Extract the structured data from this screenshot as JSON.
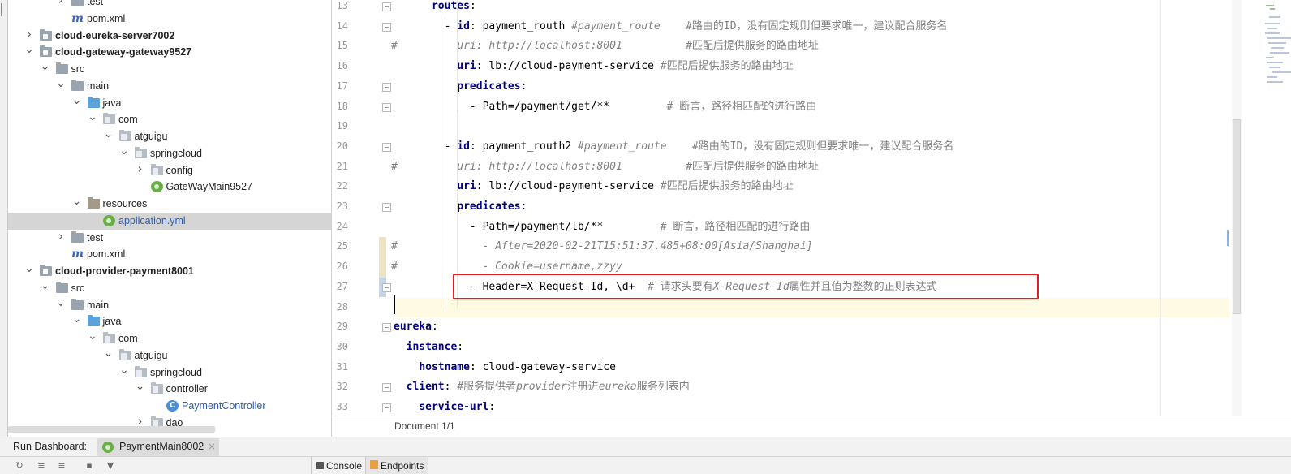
{
  "project_tree": {
    "rows": [
      {
        "label": "test",
        "depth": 3,
        "arrow": ">",
        "icon": "folder-icon",
        "style": "normal"
      },
      {
        "label": "pom.xml",
        "depth": 3,
        "arrow": "",
        "icon": "maven-icon",
        "style": "normal"
      },
      {
        "label": "cloud-eureka-server7002",
        "depth": 1,
        "arrow": ">",
        "icon": "module-folder-icon",
        "style": "bold"
      },
      {
        "label": "cloud-gateway-gateway9527",
        "depth": 1,
        "arrow": "v",
        "icon": "module-folder-icon",
        "style": "bold"
      },
      {
        "label": "src",
        "depth": 2,
        "arrow": "v",
        "icon": "folder-icon",
        "style": "normal"
      },
      {
        "label": "main",
        "depth": 3,
        "arrow": "v",
        "icon": "folder-icon",
        "style": "normal"
      },
      {
        "label": "java",
        "depth": 4,
        "arrow": "v",
        "icon": "source-folder-icon",
        "style": "normal"
      },
      {
        "label": "com",
        "depth": 5,
        "arrow": "v",
        "icon": "package-icon",
        "style": "normal"
      },
      {
        "label": "atguigu",
        "depth": 6,
        "arrow": "v",
        "icon": "package-icon",
        "style": "normal"
      },
      {
        "label": "springcloud",
        "depth": 7,
        "arrow": "v",
        "icon": "package-icon",
        "style": "normal"
      },
      {
        "label": "config",
        "depth": 8,
        "arrow": ">",
        "icon": "package-icon",
        "style": "normal"
      },
      {
        "label": "GateWayMain9527",
        "depth": 8,
        "arrow": "",
        "icon": "spring-boot-class-icon",
        "style": "normal"
      },
      {
        "label": "resources",
        "depth": 4,
        "arrow": "v",
        "icon": "resources-folder-icon",
        "style": "normal"
      },
      {
        "label": "application.yml",
        "depth": 5,
        "arrow": "",
        "icon": "spring-yaml-icon",
        "style": "selected"
      },
      {
        "label": "test",
        "depth": 3,
        "arrow": ">",
        "icon": "folder-icon",
        "style": "normal"
      },
      {
        "label": "pom.xml",
        "depth": 3,
        "arrow": "",
        "icon": "maven-icon",
        "style": "normal"
      },
      {
        "label": "cloud-provider-payment8001",
        "depth": 1,
        "arrow": "v",
        "icon": "module-folder-icon",
        "style": "bold"
      },
      {
        "label": "src",
        "depth": 2,
        "arrow": "v",
        "icon": "folder-icon",
        "style": "normal"
      },
      {
        "label": "main",
        "depth": 3,
        "arrow": "v",
        "icon": "folder-icon",
        "style": "normal"
      },
      {
        "label": "java",
        "depth": 4,
        "arrow": "v",
        "icon": "source-folder-icon",
        "style": "normal"
      },
      {
        "label": "com",
        "depth": 5,
        "arrow": "v",
        "icon": "package-icon",
        "style": "normal"
      },
      {
        "label": "atguigu",
        "depth": 6,
        "arrow": "v",
        "icon": "package-icon",
        "style": "normal"
      },
      {
        "label": "springcloud",
        "depth": 7,
        "arrow": "v",
        "icon": "package-icon",
        "style": "normal"
      },
      {
        "label": "controller",
        "depth": 8,
        "arrow": "v",
        "icon": "package-icon",
        "style": "normal"
      },
      {
        "label": "PaymentController",
        "depth": 9,
        "arrow": "",
        "icon": "java-class-icon",
        "style": "blue"
      },
      {
        "label": "dao",
        "depth": 8,
        "arrow": ">",
        "icon": "package-icon",
        "style": "normal"
      }
    ]
  },
  "editor": {
    "lines": [
      {
        "num": "13",
        "comment_mark": "",
        "segments": [
          [
            "p",
            "      "
          ],
          [
            "k",
            "routes"
          ],
          [
            "p",
            ":"
          ]
        ]
      },
      {
        "num": "14",
        "comment_mark": "",
        "segments": [
          [
            "p",
            "        - "
          ],
          [
            "k",
            "id"
          ],
          [
            "p",
            ": payment_routh "
          ],
          [
            "c",
            "#payment_route"
          ],
          [
            "p",
            "    "
          ],
          [
            "ch",
            "#路由的ID，没有固定规则但要求唯一，建议配合服务名"
          ]
        ]
      },
      {
        "num": "15",
        "comment_mark": "#",
        "segments": [
          [
            "p",
            "          "
          ],
          [
            "c",
            "uri: http://localhost:8001"
          ],
          [
            "p",
            "          "
          ],
          [
            "ch",
            "#匹配后提供服务的路由地址"
          ]
        ]
      },
      {
        "num": "16",
        "comment_mark": "",
        "segments": [
          [
            "p",
            "          "
          ],
          [
            "k",
            "uri"
          ],
          [
            "p",
            ": lb://cloud-payment-service "
          ],
          [
            "ch",
            "#匹配后提供服务的路由地址"
          ]
        ]
      },
      {
        "num": "17",
        "comment_mark": "",
        "segments": [
          [
            "p",
            "          "
          ],
          [
            "k",
            "predicates"
          ],
          [
            "p",
            ":"
          ]
        ]
      },
      {
        "num": "18",
        "comment_mark": "",
        "segments": [
          [
            "p",
            "            - Path=/payment/get/**         "
          ],
          [
            "ch",
            "# 断言，路径相匹配的进行路由"
          ]
        ]
      },
      {
        "num": "19",
        "comment_mark": "",
        "segments": []
      },
      {
        "num": "20",
        "comment_mark": "",
        "segments": [
          [
            "p",
            "        - "
          ],
          [
            "k",
            "id"
          ],
          [
            "p",
            ": payment_routh2 "
          ],
          [
            "c",
            "#payment_route"
          ],
          [
            "p",
            "    "
          ],
          [
            "ch",
            "#路由的ID，没有固定规则但要求唯一，建议配合服务名"
          ]
        ]
      },
      {
        "num": "21",
        "comment_mark": "#",
        "segments": [
          [
            "p",
            "          "
          ],
          [
            "c",
            "uri: http://localhost:8001"
          ],
          [
            "p",
            "          "
          ],
          [
            "ch",
            "#匹配后提供服务的路由地址"
          ]
        ]
      },
      {
        "num": "22",
        "comment_mark": "",
        "segments": [
          [
            "p",
            "          "
          ],
          [
            "k",
            "uri"
          ],
          [
            "p",
            ": lb://cloud-payment-service "
          ],
          [
            "ch",
            "#匹配后提供服务的路由地址"
          ]
        ]
      },
      {
        "num": "23",
        "comment_mark": "",
        "segments": [
          [
            "p",
            "          "
          ],
          [
            "k",
            "predicates"
          ],
          [
            "p",
            ":"
          ]
        ]
      },
      {
        "num": "24",
        "comment_mark": "",
        "segments": [
          [
            "p",
            "            - Path=/payment/lb/**         "
          ],
          [
            "ch",
            "# 断言，路径相匹配的进行路由"
          ]
        ]
      },
      {
        "num": "25",
        "comment_mark": "#",
        "segments": [
          [
            "p",
            "              "
          ],
          [
            "c",
            "- After=2020-02-21T15:51:37.485+08:00[Asia/Shanghai]"
          ]
        ]
      },
      {
        "num": "26",
        "comment_mark": "#",
        "segments": [
          [
            "p",
            "              "
          ],
          [
            "c",
            "- Cookie=username,zzyy"
          ]
        ]
      },
      {
        "num": "27",
        "comment_mark": "",
        "segments": [
          [
            "p",
            "            - Header=X-Request-Id, \\d+  "
          ],
          [
            "ch",
            "# 请求头要有"
          ],
          [
            "c",
            "X-Request-Id"
          ],
          [
            "ch",
            "属性并且值为整数的正则表达式"
          ]
        ]
      },
      {
        "num": "28",
        "comment_mark": "",
        "segments": []
      },
      {
        "num": "29",
        "comment_mark": "",
        "segments": [
          [
            "k",
            "eureka"
          ],
          [
            "p",
            ":"
          ]
        ]
      },
      {
        "num": "30",
        "comment_mark": "",
        "segments": [
          [
            "p",
            "  "
          ],
          [
            "k",
            "instance"
          ],
          [
            "p",
            ":"
          ]
        ]
      },
      {
        "num": "31",
        "comment_mark": "",
        "segments": [
          [
            "p",
            "    "
          ],
          [
            "k",
            "hostname"
          ],
          [
            "p",
            ": cloud-gateway-service"
          ]
        ]
      },
      {
        "num": "32",
        "comment_mark": "",
        "segments": [
          [
            "p",
            "  "
          ],
          [
            "k",
            "client"
          ],
          [
            "p",
            ": "
          ],
          [
            "ch",
            "#服务提供者"
          ],
          [
            "c",
            "provider"
          ],
          [
            "ch",
            "注册进"
          ],
          [
            "c",
            "eureka"
          ],
          [
            "ch",
            "服务列表内"
          ]
        ]
      },
      {
        "num": "33",
        "comment_mark": "",
        "segments": [
          [
            "p",
            "    "
          ],
          [
            "k",
            "service-url"
          ],
          [
            "p",
            ":"
          ]
        ]
      }
    ],
    "breadcrumb": "Document 1/1"
  },
  "run_dashboard": {
    "title": "Run Dashboard:",
    "tab_label": "PaymentMain8002",
    "tab_close": "×"
  },
  "bottom_toolbar": {
    "console_label": "Console",
    "endpoints_label": "Endpoints"
  }
}
